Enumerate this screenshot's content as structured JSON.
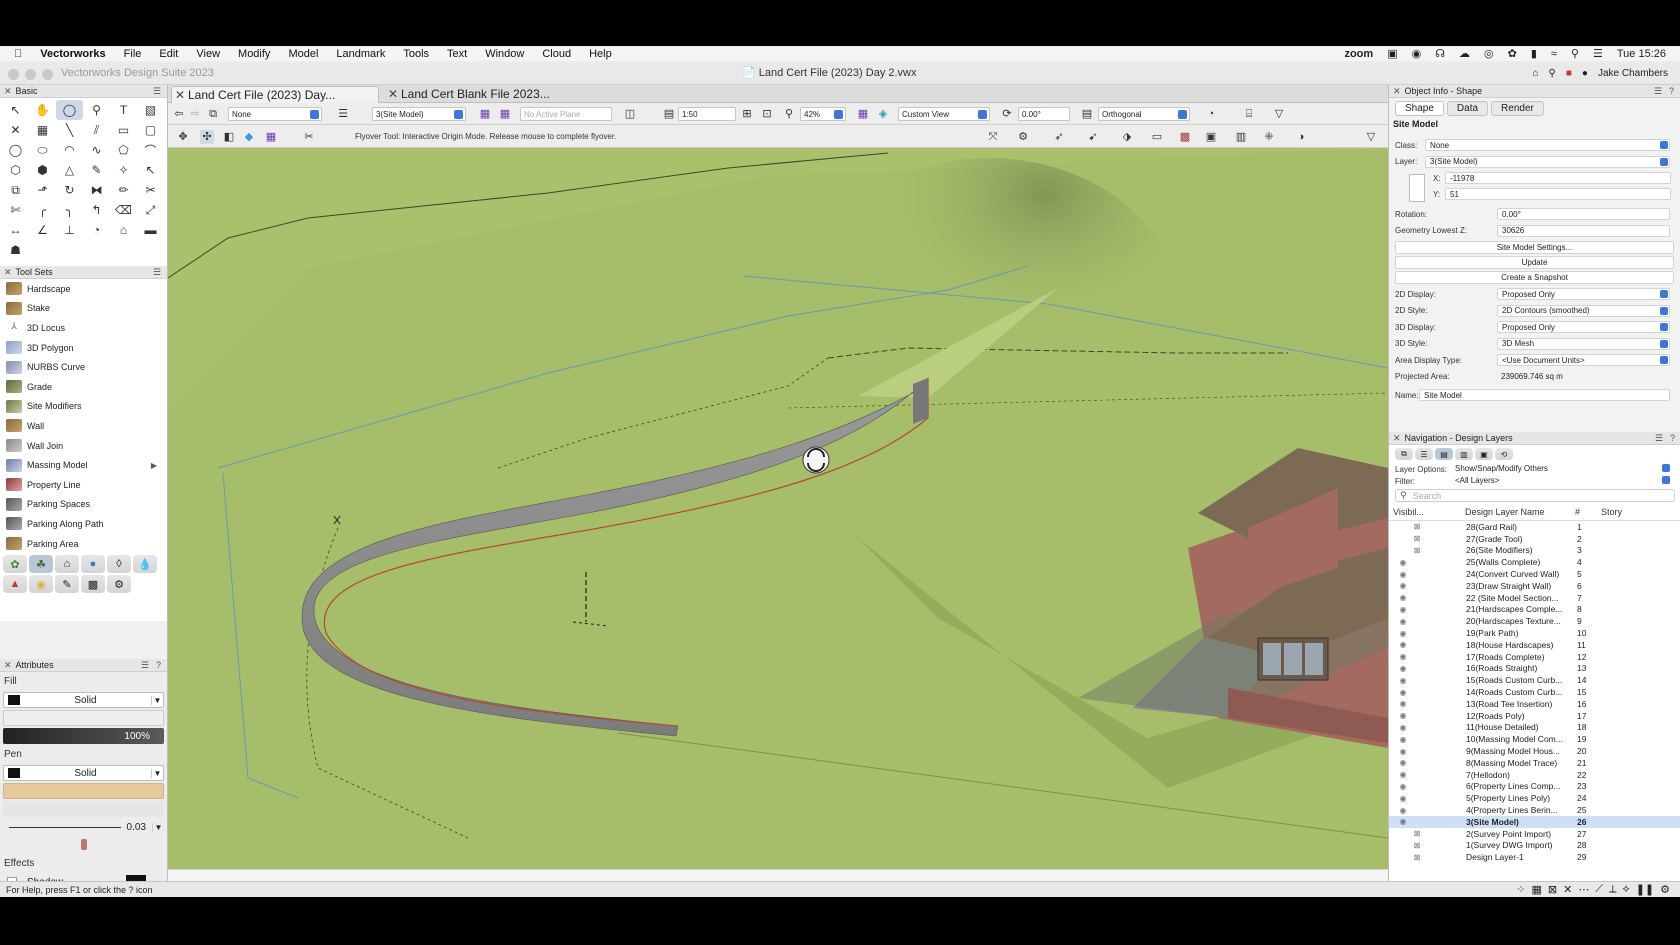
{
  "menubar": {
    "app": "Vectorworks",
    "items": [
      "File",
      "Edit",
      "View",
      "Modify",
      "Model",
      "Landmark",
      "Tools",
      "Text",
      "Window",
      "Cloud",
      "Help"
    ],
    "zoom_label": "zoom",
    "clock": "Tue 15:26"
  },
  "window": {
    "app_title": "Vectorworks Design Suite 2023",
    "doc_title": "Land Cert File (2023) Day 2.vwx",
    "user": "Jake Chambers"
  },
  "doc_tabs": [
    {
      "label": "Land Cert File (2023) Day...",
      "active": true
    },
    {
      "label": "Land Cert Blank File 2023...",
      "active": false
    }
  ],
  "viewbar": {
    "class": "None",
    "layer": "3(Site Model)",
    "plane": "No Active Plane",
    "scale": "1:50",
    "zoom": "42%",
    "view": "Custom View",
    "angle": "0.00°",
    "projection": "Orthogonal"
  },
  "modebar": {
    "hint": "Flyover Tool: Interactive Origin Mode. Release mouse to complete flyover."
  },
  "basic_palette": {
    "title": "Basic"
  },
  "tool_sets": {
    "title": "Tool Sets",
    "items": [
      "Hardscape",
      "Stake",
      "3D Locus",
      "3D Polygon",
      "NURBS Curve",
      "Grade",
      "Site Modifiers",
      "Wall",
      "Wall Join",
      "Massing Model",
      "Property Line",
      "Parking Spaces",
      "Parking Along Path",
      "Parking Area"
    ]
  },
  "attributes": {
    "title": "Attributes",
    "fill_label": "Fill",
    "fill_style": "Solid",
    "opacity": "100%",
    "pen_label": "Pen",
    "pen_style": "Solid",
    "line_weight": "0.03",
    "effects_label": "Effects",
    "shadow_label": "Shadow"
  },
  "statusbar": {
    "help": "For Help, press F1 or click the ? icon"
  },
  "object_info": {
    "title": "Object Info - Shape",
    "tabs": [
      "Shape",
      "Data",
      "Render"
    ],
    "object_type": "Site Model",
    "class_label": "Class:",
    "class_value": "None",
    "layer_label": "Layer:",
    "layer_value": "3(Site Model)",
    "x_label": "X:",
    "x_value": "-11978",
    "y_label": "Y:",
    "y_value": "51",
    "rotation_label": "Rotation:",
    "rotation_value": "0.00°",
    "geom_label": "Geometry Lowest Z:",
    "geom_value": "30626",
    "btn_settings": "Site Model Settings...",
    "btn_update": "Update",
    "btn_snapshot": "Create a Snapshot",
    "d2_display_label": "2D Display:",
    "d2_display_value": "Proposed Only",
    "d2_style_label": "2D Style:",
    "d2_style_value": "2D Contours (smoothed)",
    "d3_display_label": "3D Display:",
    "d3_display_value": "Proposed Only",
    "d3_style_label": "3D Style:",
    "d3_style_value": "3D Mesh",
    "area_type_label": "Area Display Type:",
    "area_type_value": "<Use Document Units>",
    "proj_area_label": "Projected Area:",
    "proj_area_value": "239069.746 sq m",
    "name_label": "Name:",
    "name_value": "Site Model"
  },
  "navigation": {
    "title": "Navigation - Design Layers",
    "layer_options_label": "Layer Options:",
    "layer_options_value": "Show/Snap/Modify Others",
    "filter_label": "Filter:",
    "filter_value": "<All Layers>",
    "search_placeholder": "Search",
    "col_visibility": "Visibil...",
    "col_name": "Design Layer Name",
    "col_num": "#",
    "col_story": "Story",
    "layers": [
      {
        "vis": "hidden",
        "name": "28(Gard Rail)",
        "num": "1"
      },
      {
        "vis": "hidden",
        "name": "27(Grade Tool)",
        "num": "2"
      },
      {
        "vis": "hidden",
        "name": "26(Site Modifiers)",
        "num": "3"
      },
      {
        "vis": "visible",
        "name": "25(Walls Complete)",
        "num": "4"
      },
      {
        "vis": "visible",
        "name": "24(Convert Curved Wall)",
        "num": "5"
      },
      {
        "vis": "visible",
        "name": "23(Draw Straight Wall)",
        "num": "6"
      },
      {
        "vis": "visible",
        "name": "22 (Site Model Section...",
        "num": "7"
      },
      {
        "vis": "visible",
        "name": "21(Hardscapes Comple...",
        "num": "8"
      },
      {
        "vis": "visible",
        "name": "20(Hardscapes Texture...",
        "num": "9"
      },
      {
        "vis": "visible",
        "name": "19(Park Path)",
        "num": "10"
      },
      {
        "vis": "visible",
        "name": "18(House Hardscapes)",
        "num": "11"
      },
      {
        "vis": "visible",
        "name": "17(Roads Complete)",
        "num": "12"
      },
      {
        "vis": "visible",
        "name": "16(Roads Straight)",
        "num": "13"
      },
      {
        "vis": "visible",
        "name": "15(Roads Custom Curb...",
        "num": "14"
      },
      {
        "vis": "visible",
        "name": "14(Roads Custom Curb...",
        "num": "15"
      },
      {
        "vis": "visible",
        "name": "13(Road Tee Insertion)",
        "num": "16"
      },
      {
        "vis": "visible",
        "name": "12(Roads Poly)",
        "num": "17"
      },
      {
        "vis": "visible",
        "name": "11(House Detailed)",
        "num": "18"
      },
      {
        "vis": "visible",
        "name": "10(Massing Model Com...",
        "num": "19"
      },
      {
        "vis": "visible",
        "name": "9(Massing Model Hous...",
        "num": "20"
      },
      {
        "vis": "visible",
        "name": "8(Massing Model Trace)",
        "num": "21"
      },
      {
        "vis": "visible",
        "name": "7(Hellodon)",
        "num": "22"
      },
      {
        "vis": "visible",
        "name": "6(Property Lines Comp...",
        "num": "23"
      },
      {
        "vis": "visible",
        "name": "5(Property Lines Poly)",
        "num": "24"
      },
      {
        "vis": "visible",
        "name": "4(Property Lines Berin...",
        "num": "25"
      },
      {
        "vis": "visible",
        "name": "3(Site Model)",
        "num": "26",
        "selected": true
      },
      {
        "vis": "hidden",
        "name": "2(Survey Point Import)",
        "num": "27"
      },
      {
        "vis": "hidden",
        "name": "1(Survey DWG Import)",
        "num": "28"
      },
      {
        "vis": "hidden",
        "name": "Design Layer-1",
        "num": "29"
      }
    ]
  },
  "colors": {
    "terrain": "#a6bd6a",
    "wall": "#8e8e8e",
    "roof": "#7d6a55",
    "brick": "#b5706a",
    "selection": "#cfe0f5",
    "accent": "#3b78d8"
  }
}
